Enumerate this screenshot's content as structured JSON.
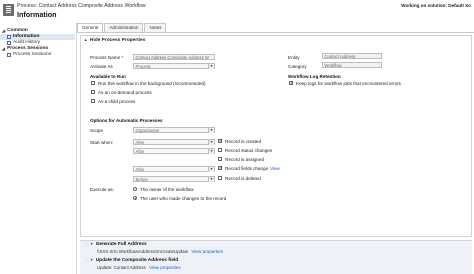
{
  "header": {
    "breadcrumb": "Process: Contact Address Composite Address Workflow",
    "title": "Information",
    "solution": "Working on solution: Default So"
  },
  "nav": {
    "groups": [
      {
        "label": "Common",
        "items": [
          {
            "label": "Information"
          },
          {
            "label": "Audit History"
          }
        ]
      },
      {
        "label": "Process Sessions",
        "items": [
          {
            "label": "Process Sessions"
          }
        ]
      }
    ]
  },
  "tabs": [
    {
      "label": "General"
    },
    {
      "label": "Administration"
    },
    {
      "label": "Notes"
    }
  ],
  "section": {
    "title": "Hide Process Properties"
  },
  "form": {
    "process_name_label": "Process Name",
    "process_name_value": "Contact Address Composite Address W",
    "activate_as_label": "Activate As",
    "activate_as_value": "Process",
    "entity_label": "Entity",
    "entity_value": "Contact Address",
    "category_label": "Category",
    "category_value": "Workflow",
    "available_header": "Available to Run",
    "run_background": "Run this workflow in the background (recommended)",
    "on_demand": "As an on-demand process",
    "child_process": "As a child process",
    "log_header": "Workflow Log Retention",
    "keep_logs": "Keep logs for workflow jobs that encountered errors",
    "options_header": "Options for Automatic Processes",
    "scope_label": "Scope",
    "scope_value": "Organization",
    "start_label": "Start when:",
    "start_after_1": "After",
    "start_after_2": "After",
    "start_after_3": "After",
    "start_before": "Before",
    "record_created": "Record is created",
    "status_changes": "Record status changes",
    "assigned": "Record is assigned",
    "fields_change": "Record fields change",
    "view_link": "View",
    "deleted": "Record is deleted",
    "execute_label": "Execute as:",
    "owner_option": "The owner of the workflow",
    "user_option": "The user who made changes to the record"
  },
  "steps": [
    {
      "title": "Generate Full Address",
      "sub_text": "\\\\XXX.Xrm.WorkflowsAddressOnCreateUpdate",
      "link": "View properties"
    },
    {
      "title": "Update the Composite Address field",
      "sub_text": "Update: Contact Address",
      "link": "View properties"
    }
  ]
}
